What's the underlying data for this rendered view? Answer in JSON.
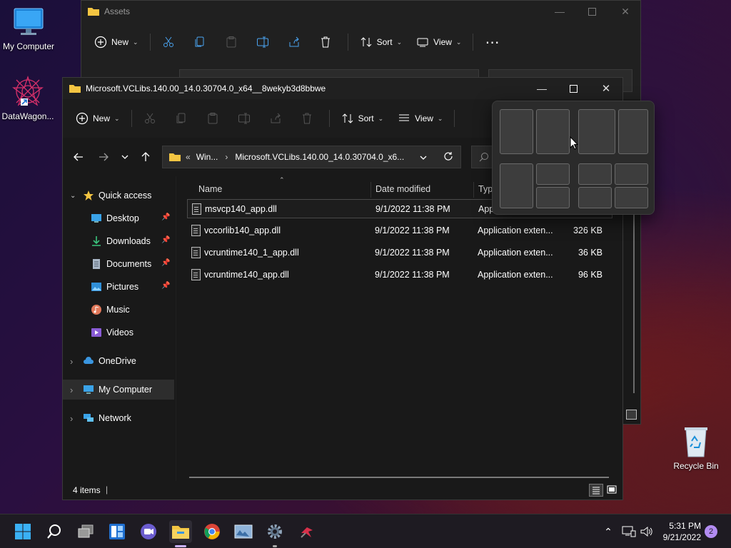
{
  "desktop": {
    "icons": [
      {
        "label": "My Computer"
      },
      {
        "label": "DataWagon..."
      },
      {
        "label": "Recycle Bin"
      }
    ]
  },
  "back_window": {
    "title": "Assets",
    "toolbar": {
      "new": "New",
      "sort": "Sort",
      "view": "View"
    }
  },
  "front_window": {
    "title": "Microsoft.VCLibs.140.00_14.0.30704.0_x64__8wekyb3d8bbwe",
    "toolbar": {
      "new": "New",
      "sort": "Sort",
      "view": "View"
    },
    "address": {
      "overflow": "«",
      "crumb1": "Win...",
      "crumb2": "Microsoft.VCLibs.140.00_14.0.30704.0_x6..."
    },
    "sidebar": {
      "quick_access": "Quick access",
      "desktop": "Desktop",
      "downloads": "Downloads",
      "documents": "Documents",
      "pictures": "Pictures",
      "music": "Music",
      "videos": "Videos",
      "onedrive": "OneDrive",
      "my_computer": "My Computer",
      "network": "Network"
    },
    "columns": {
      "name": "Name",
      "date": "Date modified",
      "type": "Typ"
    },
    "files": [
      {
        "name": "msvcp140_app.dll",
        "date": "9/1/2022 11:38 PM",
        "type": "App",
        "size": ""
      },
      {
        "name": "vccorlib140_app.dll",
        "date": "9/1/2022 11:38 PM",
        "type": "Application exten...",
        "size": "326 KB"
      },
      {
        "name": "vcruntime140_1_app.dll",
        "date": "9/1/2022 11:38 PM",
        "type": "Application exten...",
        "size": "36 KB"
      },
      {
        "name": "vcruntime140_app.dll",
        "date": "9/1/2022 11:38 PM",
        "type": "Application exten...",
        "size": "96 KB"
      }
    ],
    "status": {
      "count": "4 items",
      "cursor": "|"
    }
  },
  "taskbar": {
    "time": "5:31 PM",
    "date": "9/21/2022",
    "notification_count": "2"
  },
  "colors": {
    "window_bg": "#202020",
    "pane_bg": "#191919",
    "folder_yellow": "#f4c542",
    "accent_blue": "#4aa3f0"
  }
}
